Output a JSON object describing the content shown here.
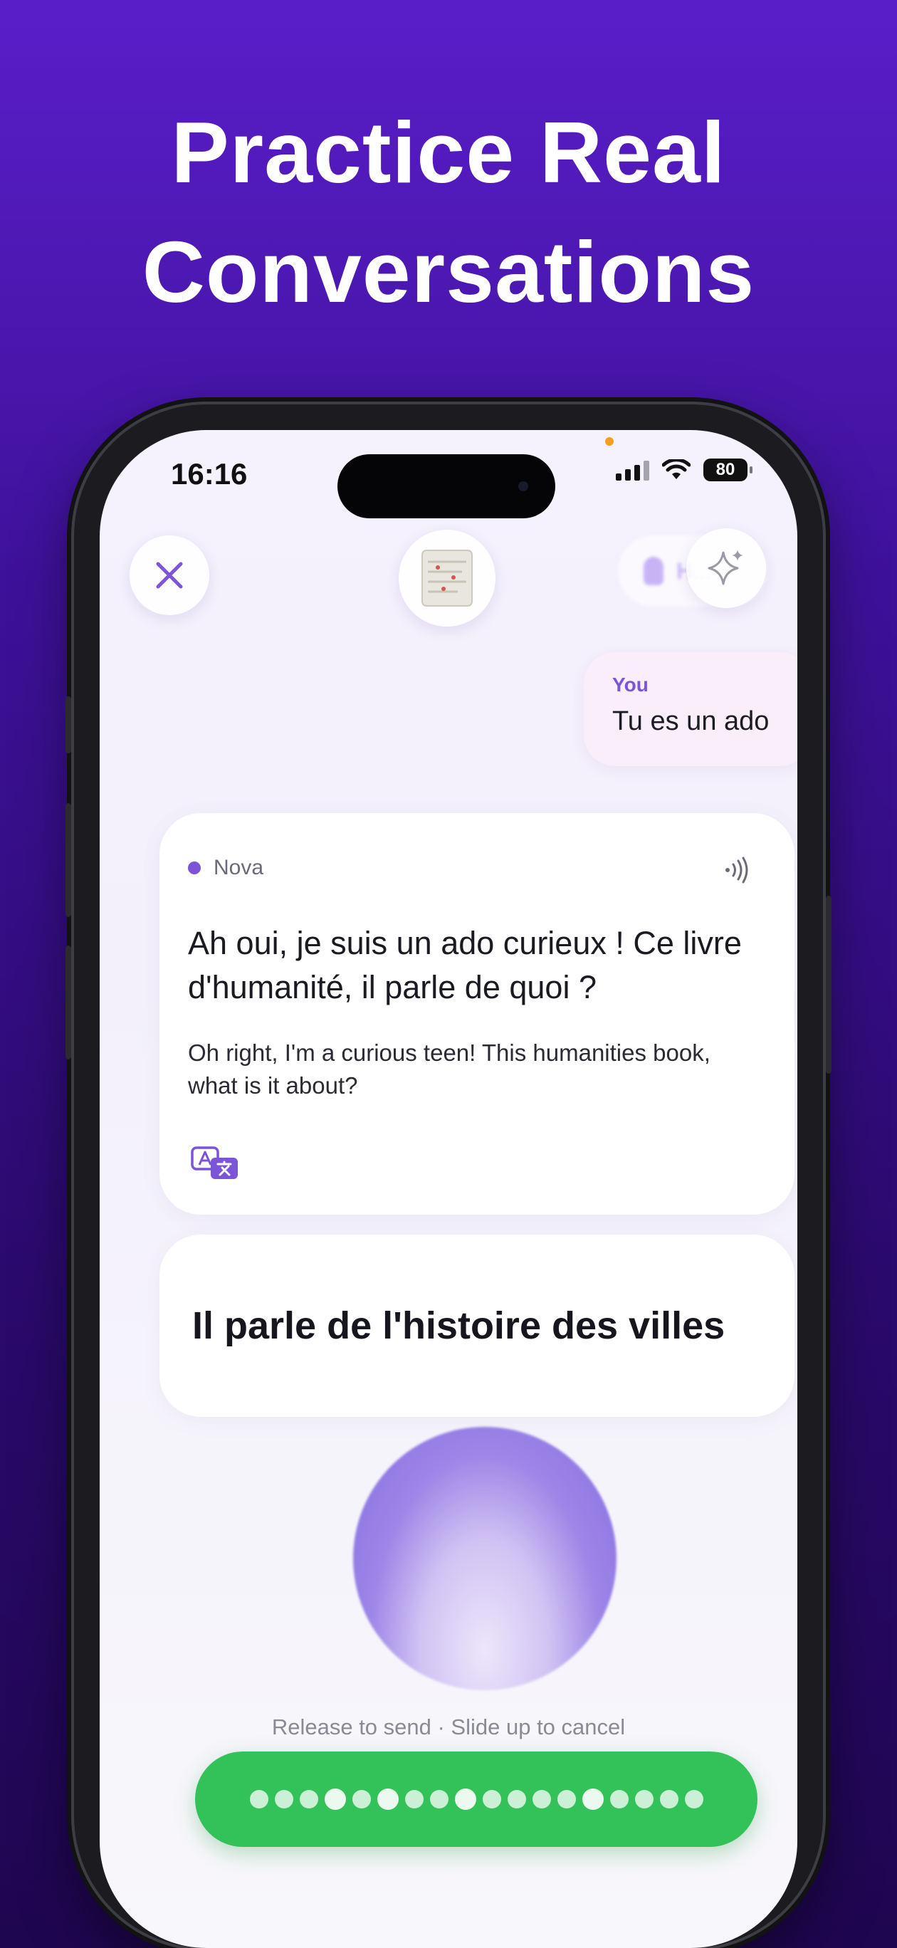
{
  "headline": {
    "line1": "Practice Real",
    "line2": "Conversations"
  },
  "status_bar": {
    "time": "16:16",
    "battery": "80",
    "icons": [
      "signal-icon",
      "wifi-icon",
      "battery-icon"
    ]
  },
  "top_bar": {
    "close_icon": "close-icon",
    "thumbnail": "book-thumbnail",
    "magic_icon": "sparkles-icon",
    "hint_label": "H..."
  },
  "user_message": {
    "label": "You",
    "text": "Tu es un ado"
  },
  "assistant_message": {
    "name": "Nova",
    "text": "Ah oui, je suis un ado curieux ! Ce livre d'humanité, il parle de quoi ?",
    "translation": "Oh right, I'm a curious teen! This humanities book, what is it about?"
  },
  "draft_answer": "Il parle de l'histoire des villes",
  "recording": {
    "hint": "Release to send · Slide up to cancel",
    "level_dots": 18
  },
  "colors": {
    "accent": "#7b54d8",
    "record_green": "#33c25a",
    "background_top": "#5a1ec9"
  }
}
